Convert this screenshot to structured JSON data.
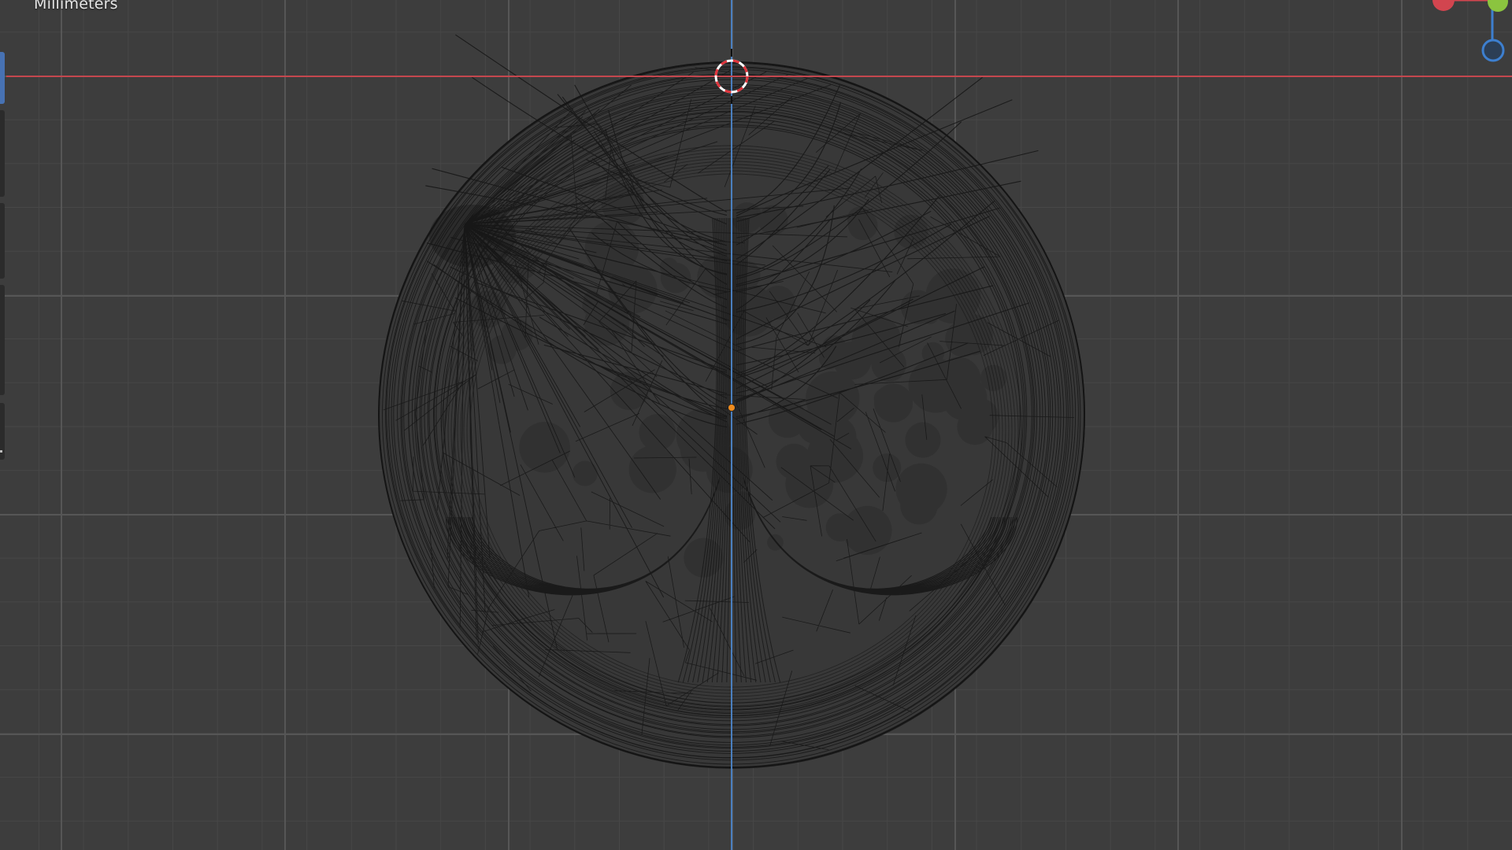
{
  "viewport": {
    "unit_label": "Millimeters",
    "view_axis": "front-orthographic",
    "background_color": "#3d3d3d",
    "grid_minor_color": "#474747",
    "grid_major_color": "#565656",
    "x_axis_color": "#c4474e",
    "z_axis_color": "#4a7fbf",
    "wire_color": "#151515",
    "origin_color": "#f08c1e",
    "cursor_ring_colors": [
      "#e0343c",
      "#ffffff"
    ]
  },
  "object": {
    "name_visible": false,
    "shape": "disc",
    "relief": "tree-of-life",
    "shading": "wireframe"
  },
  "gizmo": {
    "axes": [
      {
        "name": "x",
        "color": "#d2454f"
      },
      {
        "name": "y",
        "color": "#8bc43f"
      },
      {
        "name": "z",
        "color": "#3d7fcf"
      }
    ]
  },
  "toolbar": {
    "active_tool_index": 0,
    "visible": "edge-only"
  }
}
